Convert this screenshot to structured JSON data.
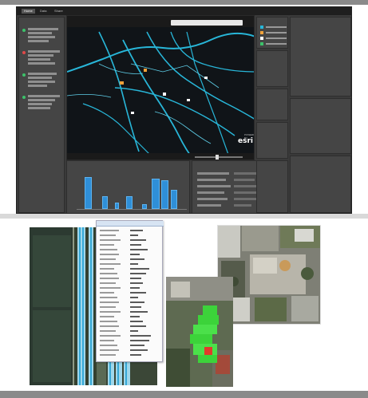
{
  "dashboard": {
    "tabs": [
      "Home",
      "Data",
      "Share"
    ],
    "title_bar": "",
    "map": {
      "panel_title": "",
      "attribution": "esri",
      "attribution_sub": "POWERED BY"
    },
    "left_panel": {
      "title": ""
    },
    "chart_panel": {
      "title": ""
    },
    "right_panels": []
  },
  "bottom": {
    "popup_title": ""
  },
  "colors": {
    "dashboard_bg": "#3a3a3a",
    "panel_bg": "#454545",
    "map_bg": "#101418",
    "road_cyan": "#28b6d8",
    "bar_blue": "#2f8fd8"
  }
}
